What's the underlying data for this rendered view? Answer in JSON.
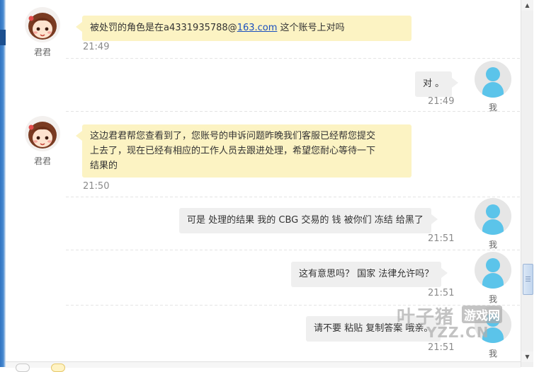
{
  "agent": {
    "name": "君君"
  },
  "me": {
    "name": "我"
  },
  "messages": [
    {
      "sender": "agent",
      "text_before": "被处罚的角色是在a4331935788@",
      "link": "163.com",
      "text_after": " 这个账号上对吗",
      "time": "21:49"
    },
    {
      "sender": "me",
      "text": "对 。",
      "time": "21:49"
    },
    {
      "sender": "agent",
      "lines": [
        "这边君君帮您查看到了，您账号的申诉问题昨晚我们客服已经帮您提交",
        "上去了，现在已经有相应的工作人员去跟进处理，希望您耐心等待一下",
        "结果的"
      ],
      "time": "21:50"
    },
    {
      "sender": "me",
      "text": "可是 处理的结果 我的 CBG 交易的 钱  被你们  冻结 给黑了",
      "time": "21:51"
    },
    {
      "sender": "me",
      "text": "这有意思吗？  国家 法律允许吗？",
      "time": "21:51"
    },
    {
      "sender": "me",
      "text": "请不要  粘贴  复制答案 哦亲。",
      "time": "21:51"
    }
  ],
  "watermark": {
    "logo": "叶子猪",
    "sub": "游戏网",
    "url": "YZZ.CN"
  },
  "scrollbar": {
    "up": "▲",
    "down": "▼"
  },
  "colors": {
    "agent_bubble": "#fcf3c3",
    "me_bubble": "#efefef",
    "avatar_me": "#5bc4ea",
    "link": "#1a4fbf"
  }
}
